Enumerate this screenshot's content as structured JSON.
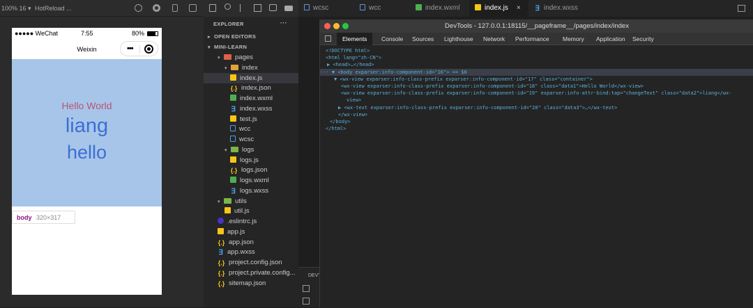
{
  "simulator": {
    "zoom_label": "100% 16 ▾",
    "hot_reload": "HotReload ...",
    "status_carrier": "●●●●● WeChat",
    "status_time": "7:55",
    "status_battery": "80%",
    "nav_title": "Weixin",
    "capsule_dots": "•••",
    "data1_text": "Hello World",
    "data2_text": "liang",
    "data3_text": "hello",
    "tooltip_tag": "body",
    "tooltip_size": "320×317"
  },
  "explorer": {
    "title": "EXPLORER",
    "more": "···",
    "open_editors": "OPEN EDITORS",
    "project": "MINI-LEARN",
    "items": [
      {
        "label": "pages",
        "icon": "folder-pages-icon"
      },
      {
        "label": "index",
        "icon": "folder-icon"
      },
      {
        "label": "index.js",
        "icon": "js-file-icon"
      },
      {
        "label": "index.json",
        "icon": "json-file-icon"
      },
      {
        "label": "index.wxml",
        "icon": "wxml-file-icon"
      },
      {
        "label": "index.wxss",
        "icon": "wxss-file-icon"
      },
      {
        "label": "test.js",
        "icon": "js-file-icon"
      },
      {
        "label": "wcc",
        "icon": "file-icon"
      },
      {
        "label": "wcsc",
        "icon": "file-icon"
      },
      {
        "label": "logs",
        "icon": "folder-icon"
      },
      {
        "label": "logs.js",
        "icon": "js-file-icon"
      },
      {
        "label": "logs.json",
        "icon": "json-file-icon"
      },
      {
        "label": "logs.wxml",
        "icon": "wxml-file-icon"
      },
      {
        "label": "logs.wxss",
        "icon": "wxss-file-icon"
      },
      {
        "label": "utils",
        "icon": "folder-icon"
      },
      {
        "label": "util.js",
        "icon": "js-file-icon"
      },
      {
        "label": ".eslintrc.js",
        "icon": "eslint-icon"
      },
      {
        "label": "app.js",
        "icon": "js-file-icon"
      },
      {
        "label": "app.json",
        "icon": "json-file-icon"
      },
      {
        "label": "app.wxss",
        "icon": "wxss-file-icon"
      },
      {
        "label": "project.config.json",
        "icon": "json-file-icon"
      },
      {
        "label": "project.private.config...",
        "icon": "json-file-icon"
      },
      {
        "label": "sitemap.json",
        "icon": "json-file-icon"
      }
    ]
  },
  "tabs": [
    "wcsc",
    "wcc",
    "index.wxml",
    "index.js",
    "index.wxss"
  ],
  "tab_close": "×",
  "devtools": {
    "title": "DevTools - 127.0.0.1:18115/__pageframe__/pages/index/index",
    "tabs": [
      "Elements",
      "Console",
      "Sources",
      "Lighthouse",
      "Network",
      "Performance",
      "Memory",
      "Application",
      "Security"
    ],
    "dom_lines": [
      "<!DOCTYPE html>",
      "<html lang=\"zh-CN\">",
      "▶ <head>…</head>",
      "··· ▼ <body exparser:info-component-id=\"16\"> == $0",
      "▼ <wx-view exparser:info-class-prefix exparser:info-component-id=\"17\" class=\"container\">",
      "<wx-view exparser:info-class-prefix exparser:info-component-id=\"18\" class=\"data1\">Hello World</wx-view>",
      "<wx-view exparser:info-class-prefix exparser:info-component-id=\"19\" exparser:info-attr-bind:tap=\"changeText\" class=\"data2\">liang</wx-",
      "view>",
      "▶ <wx-text exparser:info-class-prefix exparser:info-component-id=\"20\" class=\"data3\">…</wx-text>",
      "</wx-view>",
      "</body>",
      "</html>"
    ]
  },
  "bottom_panel": {
    "label": "DEVT"
  },
  "colors": {
    "accent": "#5db0d7",
    "page_bg": "#a7c5e8",
    "data1": "#b4567a",
    "data2": "#3c6fd6"
  }
}
